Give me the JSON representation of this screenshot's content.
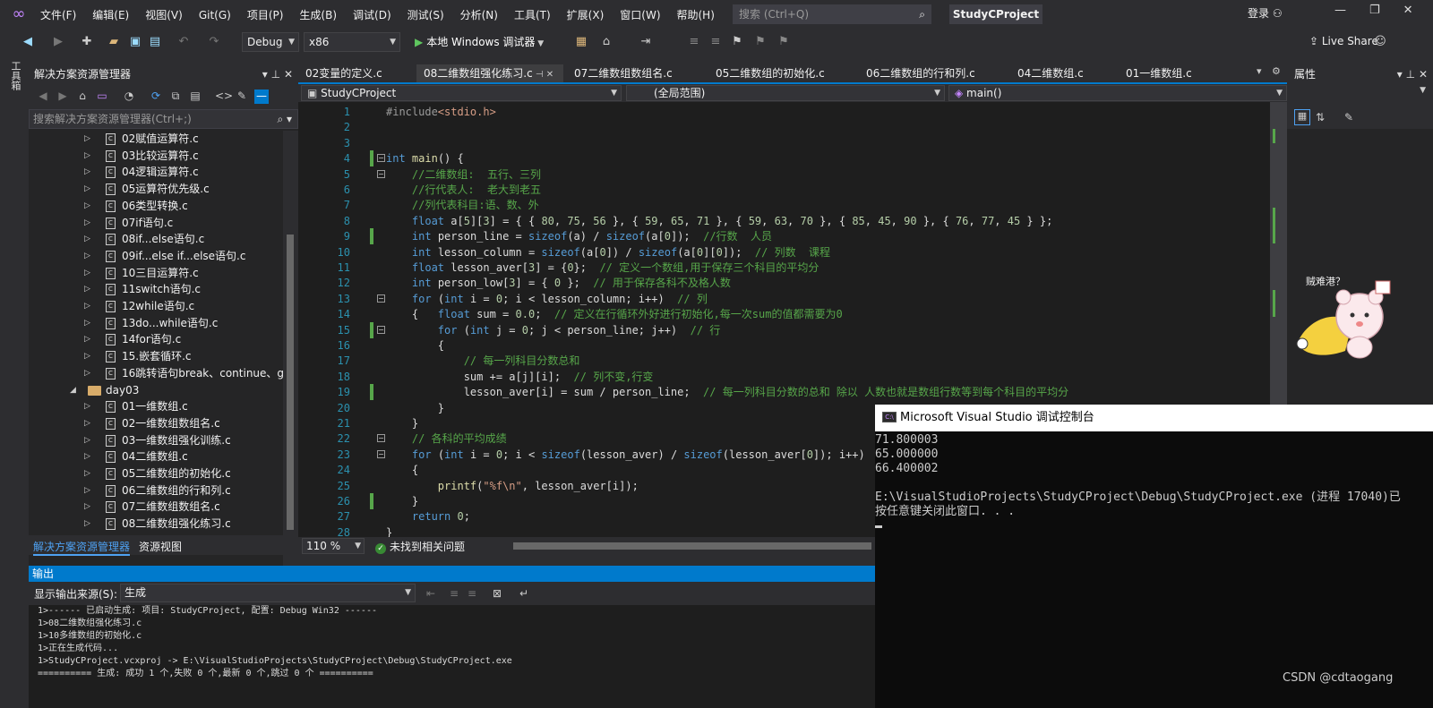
{
  "menubar": {
    "items": [
      "文件(F)",
      "编辑(E)",
      "视图(V)",
      "Git(G)",
      "项目(P)",
      "生成(B)",
      "调试(D)",
      "测试(S)",
      "分析(N)",
      "工具(T)",
      "扩展(X)",
      "窗口(W)",
      "帮助(H)"
    ],
    "search_placeholder": "搜索 (Ctrl+Q)",
    "project_name": "StudyCProject",
    "login": "登录"
  },
  "toolbar": {
    "config": "Debug",
    "platform": "x86",
    "run_label": "本地 Windows 调试器",
    "live_share": "Live Share"
  },
  "left_strip": {
    "label": "工具箱"
  },
  "solution_explorer": {
    "title": "解决方案资源管理器",
    "search_placeholder": "搜索解决方案资源管理器(Ctrl+;)",
    "items": [
      {
        "label": "02赋值运算符.c",
        "type": "file"
      },
      {
        "label": "03比较运算符.c",
        "type": "file"
      },
      {
        "label": "04逻辑运算符.c",
        "type": "file"
      },
      {
        "label": "05运算符优先级.c",
        "type": "file"
      },
      {
        "label": "06类型转换.c",
        "type": "file"
      },
      {
        "label": "07if语句.c",
        "type": "file"
      },
      {
        "label": "08if...else语句.c",
        "type": "file"
      },
      {
        "label": "09if...else if...else语句.c",
        "type": "file"
      },
      {
        "label": "10三目运算符.c",
        "type": "file"
      },
      {
        "label": "11switch语句.c",
        "type": "file"
      },
      {
        "label": "12while语句.c",
        "type": "file"
      },
      {
        "label": "13do...while语句.c",
        "type": "file"
      },
      {
        "label": "14for语句.c",
        "type": "file"
      },
      {
        "label": "15.嵌套循环.c",
        "type": "file"
      },
      {
        "label": "16跳转语句break、continue、g",
        "type": "file"
      },
      {
        "label": "day03",
        "type": "folder"
      },
      {
        "label": "01一维数组.c",
        "type": "file"
      },
      {
        "label": "02一维数组数组名.c",
        "type": "file"
      },
      {
        "label": "03一维数组强化训练.c",
        "type": "file"
      },
      {
        "label": "04二维数组.c",
        "type": "file"
      },
      {
        "label": "05二维数组的初始化.c",
        "type": "file"
      },
      {
        "label": "06二维数组的行和列.c",
        "type": "file"
      },
      {
        "label": "07二维数组数组名.c",
        "type": "file"
      },
      {
        "label": "08二维数组强化练习.c",
        "type": "file"
      }
    ],
    "bottom_tabs": [
      "解决方案资源管理器",
      "资源视图"
    ]
  },
  "doc_tabs": [
    {
      "label": "02变量的定义.c",
      "active": false
    },
    {
      "label": "08二维数组强化练习.c",
      "active": true
    },
    {
      "label": "07二维数组数组名.c",
      "active": false
    },
    {
      "label": "05二维数组的初始化.c",
      "active": false
    },
    {
      "label": "06二维数组的行和列.c",
      "active": false
    },
    {
      "label": "04二维数组.c",
      "active": false
    },
    {
      "label": "01一维数组.c",
      "active": false
    }
  ],
  "navbar": {
    "project": "StudyCProject",
    "scope": "(全局范围)",
    "member": "main()"
  },
  "editor": {
    "lines": [
      {
        "n": "1",
        "code": "#include<stdio.h>"
      },
      {
        "n": "2",
        "code": ""
      },
      {
        "n": "3",
        "code": ""
      },
      {
        "n": "4",
        "code": "int main() {"
      },
      {
        "n": "5",
        "code": "    //二维数组:  五行、三列"
      },
      {
        "n": "6",
        "code": "    //行代表人:  老大到老五"
      },
      {
        "n": "7",
        "code": "    //列代表科目:语、数、外"
      },
      {
        "n": "8",
        "code": "    float a[5][3] = { { 80, 75, 56 }, { 59, 65, 71 }, { 59, 63, 70 }, { 85, 45, 90 }, { 76, 77, 45 } };"
      },
      {
        "n": "9",
        "code": "    int person_line = sizeof(a) / sizeof(a[0]);  //行数  人员"
      },
      {
        "n": "10",
        "code": "    int lesson_column = sizeof(a[0]) / sizeof(a[0][0]);  // 列数  课程"
      },
      {
        "n": "11",
        "code": "    float lesson_aver[3] = {0};  // 定义一个数组,用于保存三个科目的平均分"
      },
      {
        "n": "12",
        "code": "    int person_low[3] = { 0 };  // 用于保存各科不及格人数"
      },
      {
        "n": "13",
        "code": "    for (int i = 0; i < lesson_column; i++)  // 列"
      },
      {
        "n": "14",
        "code": "    {   float sum = 0.0;  // 定义在行循环外好进行初始化,每一次sum的值都需要为0"
      },
      {
        "n": "15",
        "code": "        for (int j = 0; j < person_line; j++)  // 行"
      },
      {
        "n": "16",
        "code": "        {"
      },
      {
        "n": "17",
        "code": "            // 每一列科目分数总和"
      },
      {
        "n": "18",
        "code": "            sum += a[j][i];  // 列不变,行变"
      },
      {
        "n": "19",
        "code": "            lesson_aver[i] = sum / person_line;  // 每一列科目分数的总和 除以 人数也就是数组行数等到每个科目的平均分"
      },
      {
        "n": "20",
        "code": "        }"
      },
      {
        "n": "21",
        "code": "    }"
      },
      {
        "n": "22",
        "code": "    // 各科的平均成绩"
      },
      {
        "n": "23",
        "code": "    for (int i = 0; i < sizeof(lesson_aver) / sizeof(lesson_aver[0]); i++)"
      },
      {
        "n": "24",
        "code": "    {"
      },
      {
        "n": "25",
        "code": "        printf(\"%f\\n\", lesson_aver[i]);"
      },
      {
        "n": "26",
        "code": "    }"
      },
      {
        "n": "27",
        "code": "    return 0;"
      },
      {
        "n": "28",
        "code": "}"
      }
    ],
    "zoom": "110 %",
    "issues": "未找到相关问题"
  },
  "properties": {
    "title": "属性",
    "sticker_text": "贼难港？"
  },
  "output": {
    "title": "输出",
    "source_label": "显示输出来源(S):",
    "source_value": "生成",
    "lines": [
      "1>------ 已启动生成: 项目: StudyCProject, 配置: Debug Win32 ------",
      "1>08二维数组强化练习.c",
      "1>10多维数组的初始化.c",
      "1>正在生成代码...",
      "1>StudyCProject.vcxproj -> E:\\VisualStudioProjects\\StudyCProject\\Debug\\StudyCProject.exe",
      "========== 生成: 成功 1 个,失败 0 个,最新 0 个,跳过 0 个 =========="
    ]
  },
  "console": {
    "title": "Microsoft Visual Studio 调试控制台",
    "lines": [
      "71.800003",
      "65.000000",
      "66.400002",
      "",
      "E:\\VisualStudioProjects\\StudyCProject\\Debug\\StudyCProject.exe (进程 17040)已",
      "按任意键关闭此窗口. . ."
    ]
  },
  "watermark": "CSDN @cdtaogang"
}
